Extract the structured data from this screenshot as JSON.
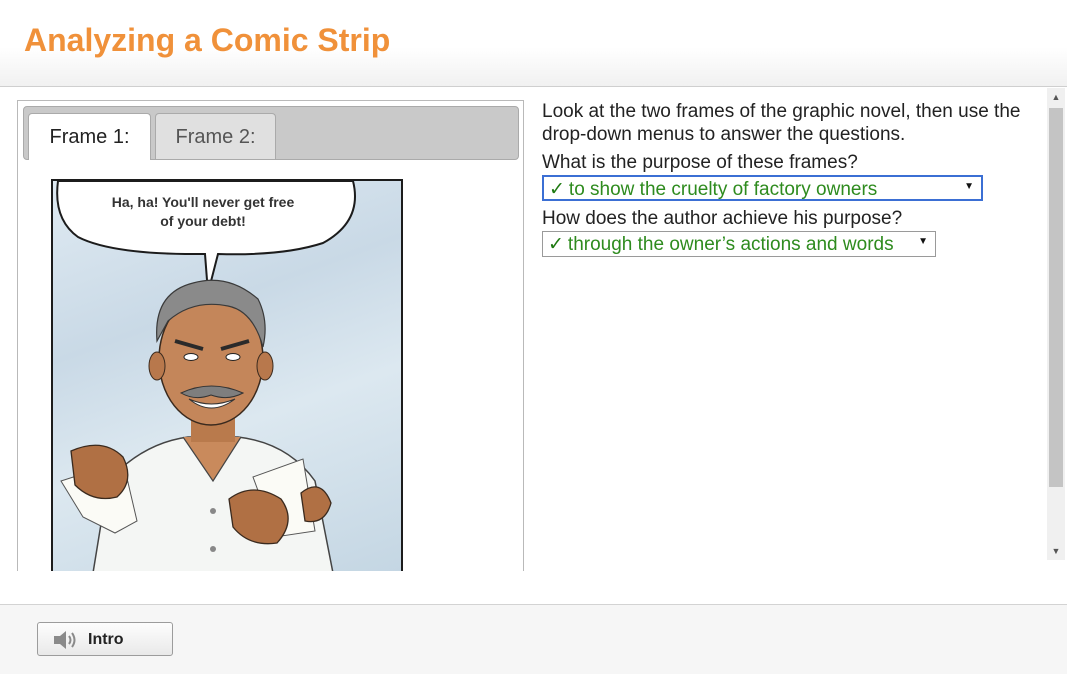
{
  "header": {
    "title": "Analyzing a Comic Strip"
  },
  "tabs": [
    {
      "label": "Frame 1:",
      "active": true
    },
    {
      "label": "Frame 2:",
      "active": false
    }
  ],
  "comic": {
    "speech_line1": "Ha, ha!  You'll never get free",
    "speech_line2": "of your debt!"
  },
  "instructions": "Look at the two frames of the graphic novel, then use the drop-down menus to answer the questions.",
  "questions": [
    {
      "prompt": "What is the purpose of these frames?",
      "answer": "to show the cruelty of factory owners",
      "status": "correct"
    },
    {
      "prompt": "How does the author achieve his purpose?",
      "answer": "through the owner’s actions and words",
      "status": "correct"
    }
  ],
  "marks": {
    "check": "✓",
    "caret": "▼"
  },
  "footer": {
    "intro_label": "Intro",
    "intro_icon": "speaker-icon"
  },
  "colors": {
    "title": "#f0913a",
    "correct": "#2e8b1e",
    "focus_border": "#3b6fd4"
  }
}
